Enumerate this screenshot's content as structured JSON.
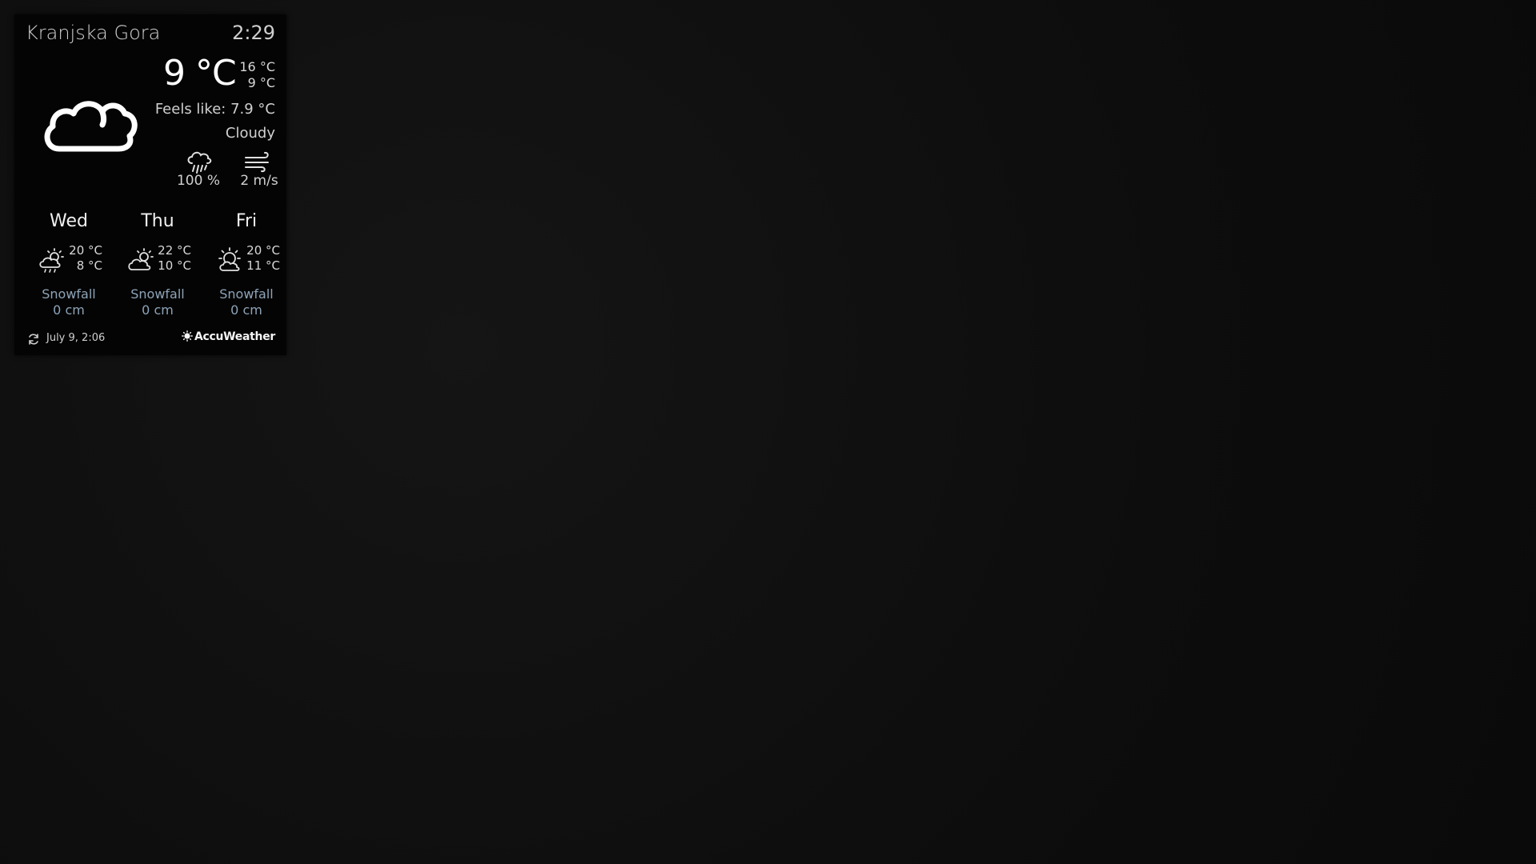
{
  "header": {
    "location": "Kranjska Gora",
    "time": "2:29"
  },
  "current": {
    "icon": "cloud-icon",
    "temperature": "9 °C",
    "high": "16 °C",
    "low": "9 °C",
    "feels_like": "Feels like: 7.9 °C",
    "condition": "Cloudy",
    "precipitation": {
      "icon": "rain-cloud-icon",
      "value": "100 %"
    },
    "wind": {
      "icon": "wind-icon",
      "value": "2 m/s"
    }
  },
  "forecast": [
    {
      "day": "Wed",
      "icon": "partly-sunny-icon",
      "high": "20 °C",
      "low": "8 °C",
      "snow_label": "Snowfall",
      "snow_value": "0 cm"
    },
    {
      "day": "Thu",
      "icon": "partly-sunny-icon",
      "high": "22 °C",
      "low": "10 °C",
      "snow_label": "Snowfall",
      "snow_value": "0 cm"
    },
    {
      "day": "Fri",
      "icon": "partly-sunny-icon",
      "high": "20 °C",
      "low": "11 °C",
      "snow_label": "Snowfall",
      "snow_value": "0 cm"
    }
  ],
  "footer": {
    "refresh_icon": "refresh-icon",
    "updated": "July  9, 2:06",
    "brand": "AccuWeather"
  },
  "colors": {
    "background": "#0f0f0f",
    "widget_background": "#040404",
    "snow_text": "#8ea4b8",
    "text": "#e8e8e8"
  }
}
